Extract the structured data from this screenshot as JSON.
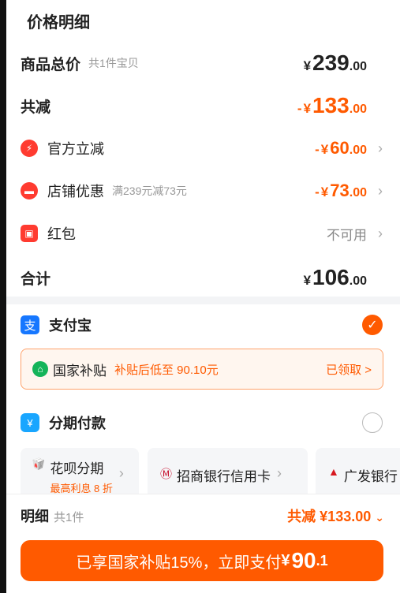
{
  "header": {
    "title": "价格明细"
  },
  "total": {
    "label": "商品总价",
    "sub": "共1件宝贝",
    "cur": "¥",
    "int": "239",
    "dec": ".00"
  },
  "reduce": {
    "label": "共减",
    "sign": "-",
    "cur": "¥",
    "int": "133",
    "dec": ".00"
  },
  "official": {
    "label": "官方立减",
    "sign": "-",
    "cur": "¥",
    "int": "60",
    "dec": ".00"
  },
  "shop": {
    "label": "店铺优惠",
    "sub": "满239元减73元",
    "sign": "-",
    "cur": "¥",
    "int": "73",
    "dec": ".00"
  },
  "redpacket": {
    "label": "红包",
    "status": "不可用"
  },
  "sum": {
    "label": "合计",
    "cur": "¥",
    "int": "106",
    "dec": ".00"
  },
  "payment": {
    "alipay": {
      "icon": "支",
      "label": "支付宝"
    },
    "subsidy": {
      "name": "国家补贴",
      "note": "补贴后低至 90.10元",
      "claim": "已领取 >"
    },
    "installment": {
      "label": "分期付款"
    },
    "options": [
      {
        "icon": "🥡",
        "label": "花呗分期",
        "extra": "最高利息 8 折"
      },
      {
        "icon": "Ⓜ",
        "label": "招商银行信用卡"
      },
      {
        "icon": "▲",
        "label": "广发银行"
      }
    ]
  },
  "bottom": {
    "detail_label": "明细",
    "detail_sub": "共1件",
    "detail_total": "共减 ¥133.00",
    "cta_text": "已享国家补贴15%，立即支付",
    "cta_cur": "¥",
    "cta_int": "90",
    "cta_dec": ".1"
  },
  "colors": {
    "accent": "#ff5a00",
    "alipay": "#1677ff",
    "subsidy_green": "#15b45a"
  }
}
